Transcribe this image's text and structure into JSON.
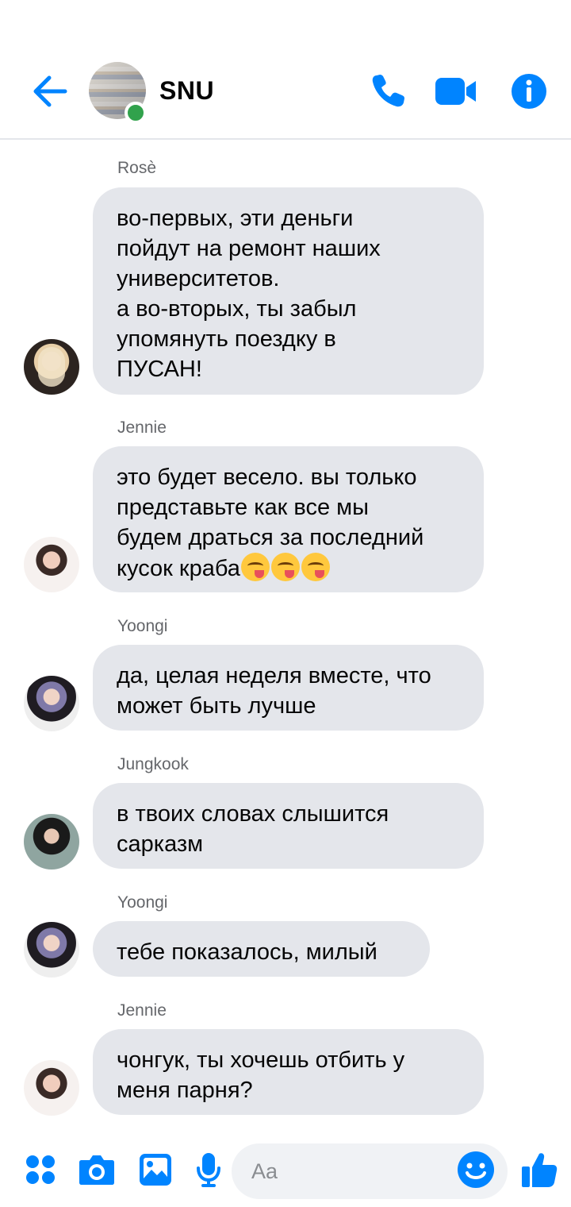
{
  "header": {
    "title": "SNU",
    "online": true,
    "icons": {
      "back": "back-arrow-icon",
      "call": "phone-icon",
      "video": "video-camera-icon",
      "info": "info-icon"
    }
  },
  "messages": [
    {
      "sender": "Rosè",
      "avatar": "rose",
      "text": "во-первых, эти деньги\nпойдут на ремонт наших\nуниверситетов.\nа во-вторых, ты забыл\nупомянуть поездку в\nПУСАН!"
    },
    {
      "sender": "Jennie",
      "avatar": "jennie",
      "text": "это будет весело. вы только\nпредставьте как все мы\nбудем драться за последний\nкусок краба",
      "emoji": [
        "😋",
        "😋",
        "😋"
      ]
    },
    {
      "sender": "Yoongi",
      "avatar": "yoongi",
      "text": "да, целая неделя вместе, что\nможет быть лучше"
    },
    {
      "sender": "Jungkook",
      "avatar": "jungkook",
      "text": "в твоих словах слышится\nсарказм"
    },
    {
      "sender": "Yoongi",
      "avatar": "yoongi",
      "text": "тебе показалось, милый"
    },
    {
      "sender": "Jennie",
      "avatar": "jennie",
      "text": "чонгук, ты хочешь отбить у\nменя парня?"
    }
  ],
  "composer": {
    "placeholder": "Aa",
    "value": "",
    "icons": [
      "menu-dots-icon",
      "camera-icon",
      "gallery-icon",
      "microphone-icon",
      "emoji-icon",
      "like-icon"
    ]
  },
  "colors": {
    "accent": "#0084ff",
    "bubble": "#e4e6eb",
    "online": "#31a24c",
    "sender": "#65676b"
  }
}
